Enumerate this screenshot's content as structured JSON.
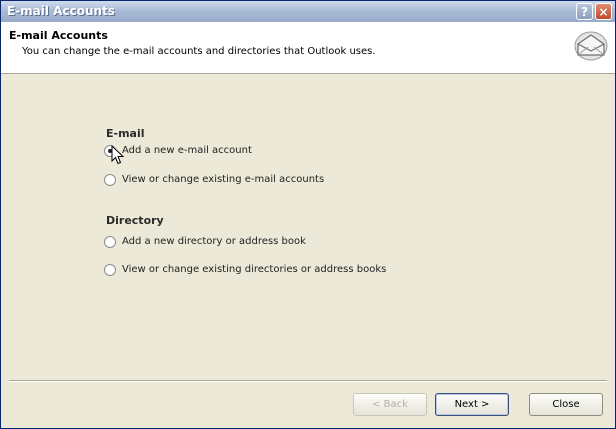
{
  "window": {
    "title": "E-mail Accounts",
    "help_label": "?",
    "close_label": "×"
  },
  "header": {
    "title": "E-mail Accounts",
    "subtitle": "You can change the e-mail accounts and directories that Outlook uses.",
    "icon": "envelope-icon"
  },
  "email_section": {
    "label": "E-mail",
    "options": [
      {
        "label": "Add a new e-mail account",
        "checked": true
      },
      {
        "label": "View or change existing e-mail accounts",
        "checked": false
      }
    ]
  },
  "directory_section": {
    "label": "Directory",
    "options": [
      {
        "label": "Add a new directory or address book",
        "checked": false
      },
      {
        "label": "View or change existing directories or address books",
        "checked": false
      }
    ]
  },
  "buttons": {
    "back": "< Back",
    "next": "Next >",
    "close": "Close"
  },
  "colors": {
    "title_bar": "#a9bbd6",
    "close_button": "#c14a2c",
    "dialog_bg": "#ece9d8"
  }
}
